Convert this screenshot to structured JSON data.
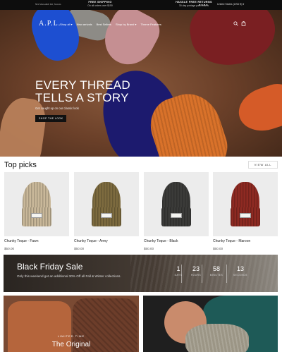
{
  "announcement": {
    "left_text": "501 Shoreditch Rd, Toronto",
    "items": [
      {
        "title": "FREE SHIPPING",
        "subtitle": "On all orders over $150"
      },
      {
        "title": "HASSLE FREE RETURNS",
        "subtitle": "30-day postage paid returns"
      }
    ],
    "social_icons": [
      "facebook-icon",
      "instagram-icon",
      "twitter-icon",
      "pinterest-icon"
    ],
    "country": "United States (USD $) ▾"
  },
  "nav": {
    "logo": "A.P.L.",
    "links": [
      "Shop all ▾",
      "New arrivals",
      "Best Sellers",
      "Shop by Brand ▾",
      "Theme Features"
    ],
    "icons": [
      "search-icon",
      "bag-icon"
    ]
  },
  "hero": {
    "heading_line1": "EVERY THREAD",
    "heading_line2": "TELLS A STORY",
    "subheading": "Get caught up on our classic look",
    "cta": "SHOP THE LOOK"
  },
  "top_picks": {
    "title": "Top picks",
    "view_all": "VIEW ALL",
    "products": [
      {
        "name": "Chunky Toque - Fawn",
        "price": "$50.00",
        "color": "#c9b89a"
      },
      {
        "name": "Chunky Toque - Army",
        "price": "$50.00",
        "color": "#7d6b3f"
      },
      {
        "name": "Chunky Toque - Black",
        "price": "$50.00",
        "color": "#3b3b39"
      },
      {
        "name": "Chunky Toque - Maroon",
        "price": "$50.00",
        "color": "#8e2a22"
      }
    ]
  },
  "promo": {
    "title": "Black Friday Sale",
    "subtitle": "Only this weekend get an additional 30% Off all Fall & Winter collections.",
    "countdown": [
      {
        "value": "1",
        "label": "DAYS"
      },
      {
        "value": "23",
        "label": "HOURS"
      },
      {
        "value": "58",
        "label": "MINUTES"
      },
      {
        "value": "13",
        "label": "SECONDS"
      }
    ]
  },
  "tiles": {
    "left_label": "LIMITED TIME",
    "left_title": "The Original"
  }
}
